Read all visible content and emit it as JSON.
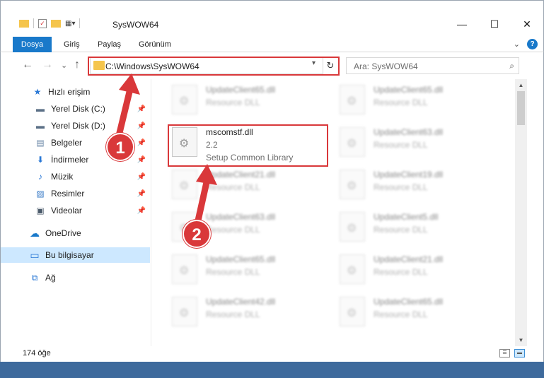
{
  "window": {
    "title": "SysWOW64",
    "controls": {
      "minimize": "—",
      "maximize": "☐",
      "close": "✕"
    }
  },
  "ribbon": {
    "tabs": [
      "Dosya",
      "Giriş",
      "Paylaş",
      "Görünüm"
    ],
    "expand_glyph": "⌄",
    "help": "?"
  },
  "nav": {
    "back_glyph": "←",
    "forward_glyph": "→",
    "recent_glyph": "⌄",
    "up_glyph": "↑",
    "address": "C:\\Windows\\SysWOW64",
    "refresh_glyph": "↻",
    "search_placeholder": "Ara: SysWOW64",
    "search_glyph": "⌕"
  },
  "sidebar": {
    "items": [
      {
        "label": "Hızlı erişim",
        "icon": "star-icon",
        "glyph": "★",
        "color": "#2b79d6",
        "pinned": false
      },
      {
        "label": "Yerel Disk (C:)",
        "icon": "drive-icon",
        "glyph": "▬",
        "color": "#5a6f86",
        "pinned": true
      },
      {
        "label": "Yerel Disk (D:)",
        "icon": "drive-icon",
        "glyph": "▬",
        "color": "#5a6f86",
        "pinned": true
      },
      {
        "label": "Belgeler",
        "icon": "documents-icon",
        "glyph": "▤",
        "color": "#6c89a8",
        "pinned": true
      },
      {
        "label": "İndirmeler",
        "icon": "download-icon",
        "glyph": "⬇",
        "color": "#2b79d6",
        "pinned": true
      },
      {
        "label": "Müzik",
        "icon": "music-icon",
        "glyph": "♪",
        "color": "#2b79d6",
        "pinned": true
      },
      {
        "label": "Resimler",
        "icon": "pictures-icon",
        "glyph": "▨",
        "color": "#3b7cc7",
        "pinned": true
      },
      {
        "label": "Videolar",
        "icon": "videos-icon",
        "glyph": "▣",
        "color": "#4a5a6a",
        "pinned": true
      },
      {
        "label": "OneDrive",
        "icon": "cloud-icon",
        "glyph": "☁",
        "color": "#1979ca",
        "pinned": false
      },
      {
        "label": "Bu bilgisayar",
        "icon": "computer-icon",
        "glyph": "▭",
        "color": "#2b79d6",
        "pinned": false
      },
      {
        "label": "Ağ",
        "icon": "network-icon",
        "glyph": "⧉",
        "color": "#2b79d6",
        "pinned": false
      }
    ],
    "pin_glyph": "📌"
  },
  "files": {
    "highlighted": {
      "name": "mscomstf.dll",
      "version": "2.2",
      "description": "Setup Common Library"
    },
    "blurred": [
      {
        "name": "UpdateClient65.dll",
        "desc": "Resource DLL"
      },
      {
        "name": "UpdateClient65.dll",
        "desc": "Resource DLL"
      },
      {
        "name": "UpdateClient63.dll",
        "desc": "Resource DLL"
      },
      {
        "name": "UpdateClient21.dll",
        "desc": "Resource DLL"
      },
      {
        "name": "UpdateClient19.dll",
        "desc": "Resource DLL"
      },
      {
        "name": "UpdateClient63.dll",
        "desc": "Resource DLL"
      },
      {
        "name": "UpdateClient5.dll",
        "desc": "Resource DLL"
      },
      {
        "name": "UpdateClient65.dll",
        "desc": "Resource DLL"
      },
      {
        "name": "UpdateClient21.dll",
        "desc": "Resource DLL"
      },
      {
        "name": "UpdateClient42.dll",
        "desc": "Resource DLL"
      },
      {
        "name": "UpdateClient65.dll",
        "desc": "Resource DLL"
      }
    ]
  },
  "status": {
    "item_count": "174 öğe"
  },
  "annotations": {
    "step1": "1",
    "step2": "2",
    "accent": "#d9383a"
  }
}
